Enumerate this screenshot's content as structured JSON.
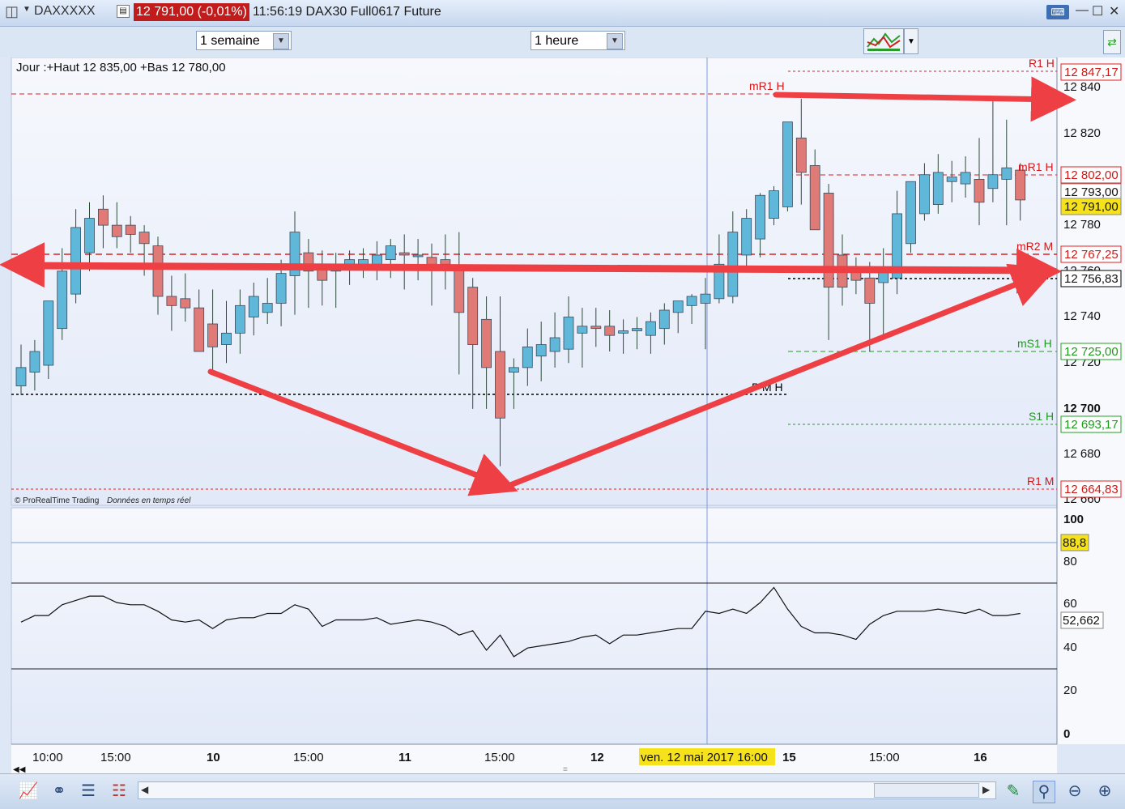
{
  "window": {
    "symbol": "DAXXXXX",
    "price_badge": "12 791,00 (-0,01%)",
    "time_title": "11:56:19 DAX30 Full0617 Future"
  },
  "toolbar": {
    "period_select": "1 semaine",
    "interval_select": "1 heure"
  },
  "chart": {
    "info_text": "Jour :+Haut 12 835,00 +Bas 12 780,00",
    "copyright": "© ProRealTime Trading",
    "realtime": "Données en temps réel",
    "crosshair_date": "ven. 12 mai 2017 16:00",
    "colors": {
      "bull": "#5fb8da",
      "bear": "#e07a77",
      "arrow": "#ee4044",
      "resistance": "#e02020",
      "support": "#20a020",
      "pivot": "#000000"
    },
    "price_ticks": [
      "12 840",
      "12 820",
      "12 780",
      "12 760",
      "12 740",
      "12 720",
      "12 700",
      "12 680",
      "12 660"
    ],
    "pivot_labels": [
      {
        "text": "R1 H",
        "tag": "12 847,17",
        "kind": "resistance"
      },
      {
        "text": "mR1 H",
        "tag": "",
        "kind": "resistance"
      },
      {
        "text": "mR1 H",
        "tag": "12 802,00",
        "kind": "resistance"
      },
      {
        "text": "mR2 M",
        "tag": "12 767,25",
        "kind": "resistance"
      },
      {
        "text": "PM",
        "tag": "12 756,83",
        "kind": "pivot"
      },
      {
        "text": "mS1 H",
        "tag": "12 725,00",
        "kind": "support"
      },
      {
        "text": "P M H",
        "tag": "",
        "kind": "pivot"
      },
      {
        "text": "S1 H",
        "tag": "12 693,17",
        "kind": "support"
      },
      {
        "text": "R1 M",
        "tag": "12 664,83",
        "kind": "resistance"
      }
    ],
    "price_tags": {
      "prev": "12 793,00",
      "last": "12 791,00"
    },
    "oscillator": {
      "ticks": [
        "100",
        "80",
        "60",
        "40",
        "20",
        "0"
      ],
      "upper_tag": "88,8",
      "value_tag": "52,662"
    },
    "x_ticks": [
      "10:00",
      "15:00",
      "10",
      "15:00",
      "11",
      "15:00",
      "12",
      "15",
      "15:00",
      "16"
    ]
  },
  "chart_data": {
    "type": "candlestick",
    "interval": "1 heure",
    "ylim": [
      12660,
      12850
    ],
    "candles": [
      {
        "o": 12710,
        "h": 12728,
        "l": 12706,
        "c": 12718
      },
      {
        "o": 12716,
        "h": 12730,
        "l": 12708,
        "c": 12725
      },
      {
        "o": 12719,
        "h": 12747,
        "l": 12713,
        "c": 12747
      },
      {
        "o": 12735,
        "h": 12770,
        "l": 12730,
        "c": 12760
      },
      {
        "o": 12750,
        "h": 12787,
        "l": 12746,
        "c": 12779
      },
      {
        "o": 12768,
        "h": 12790,
        "l": 12760,
        "c": 12783
      },
      {
        "o": 12787,
        "h": 12793,
        "l": 12770,
        "c": 12780
      },
      {
        "o": 12780,
        "h": 12790,
        "l": 12770,
        "c": 12775
      },
      {
        "o": 12780,
        "h": 12784,
        "l": 12768,
        "c": 12776
      },
      {
        "o": 12777,
        "h": 12780,
        "l": 12758,
        "c": 12772
      },
      {
        "o": 12771,
        "h": 12775,
        "l": 12741,
        "c": 12749
      },
      {
        "o": 12749,
        "h": 12758,
        "l": 12734,
        "c": 12745
      },
      {
        "o": 12748,
        "h": 12759,
        "l": 12738,
        "c": 12744
      },
      {
        "o": 12744,
        "h": 12752,
        "l": 12729,
        "c": 12725
      },
      {
        "o": 12737,
        "h": 12752,
        "l": 12716,
        "c": 12727
      },
      {
        "o": 12728,
        "h": 12747,
        "l": 12720,
        "c": 12733
      },
      {
        "o": 12733,
        "h": 12752,
        "l": 12724,
        "c": 12745
      },
      {
        "o": 12740,
        "h": 12755,
        "l": 12732,
        "c": 12749
      },
      {
        "o": 12742,
        "h": 12757,
        "l": 12737,
        "c": 12746
      },
      {
        "o": 12746,
        "h": 12765,
        "l": 12736,
        "c": 12759
      },
      {
        "o": 12758,
        "h": 12786,
        "l": 12741,
        "c": 12777
      },
      {
        "o": 12768,
        "h": 12774,
        "l": 12744,
        "c": 12760
      },
      {
        "o": 12763,
        "h": 12769,
        "l": 12745,
        "c": 12756
      },
      {
        "o": 12760,
        "h": 12768,
        "l": 12744,
        "c": 12763
      },
      {
        "o": 12763,
        "h": 12769,
        "l": 12754,
        "c": 12765
      },
      {
        "o": 12762,
        "h": 12770,
        "l": 12757,
        "c": 12765
      },
      {
        "o": 12763,
        "h": 12773,
        "l": 12756,
        "c": 12767
      },
      {
        "o": 12765,
        "h": 12774,
        "l": 12757,
        "c": 12771
      },
      {
        "o": 12768,
        "h": 12776,
        "l": 12752,
        "c": 12767
      },
      {
        "o": 12767,
        "h": 12774,
        "l": 12756,
        "c": 12767
      },
      {
        "o": 12766,
        "h": 12772,
        "l": 12745,
        "c": 12763
      },
      {
        "o": 12765,
        "h": 12776,
        "l": 12752,
        "c": 12763
      },
      {
        "o": 12762,
        "h": 12777,
        "l": 12715,
        "c": 12742
      },
      {
        "o": 12753,
        "h": 12757,
        "l": 12700,
        "c": 12728
      },
      {
        "o": 12739,
        "h": 12749,
        "l": 12700,
        "c": 12718
      },
      {
        "o": 12725,
        "h": 12749,
        "l": 12675,
        "c": 12696
      },
      {
        "o": 12716,
        "h": 12722,
        "l": 12700,
        "c": 12718
      },
      {
        "o": 12718,
        "h": 12735,
        "l": 12710,
        "c": 12727
      },
      {
        "o": 12723,
        "h": 12738,
        "l": 12712,
        "c": 12728
      },
      {
        "o": 12725,
        "h": 12742,
        "l": 12718,
        "c": 12731
      },
      {
        "o": 12726,
        "h": 12749,
        "l": 12720,
        "c": 12740
      },
      {
        "o": 12733,
        "h": 12744,
        "l": 12718,
        "c": 12736
      },
      {
        "o": 12736,
        "h": 12744,
        "l": 12727,
        "c": 12735
      },
      {
        "o": 12736,
        "h": 12743,
        "l": 12725,
        "c": 12732
      },
      {
        "o": 12733,
        "h": 12739,
        "l": 12724,
        "c": 12734
      },
      {
        "o": 12734,
        "h": 12740,
        "l": 12726,
        "c": 12735
      },
      {
        "o": 12732,
        "h": 12742,
        "l": 12724,
        "c": 12738
      },
      {
        "o": 12735,
        "h": 12746,
        "l": 12728,
        "c": 12743
      },
      {
        "o": 12742,
        "h": 12747,
        "l": 12733,
        "c": 12747
      },
      {
        "o": 12745,
        "h": 12750,
        "l": 12737,
        "c": 12749
      },
      {
        "o": 12746,
        "h": 12757,
        "l": 12726,
        "c": 12750
      },
      {
        "o": 12748,
        "h": 12776,
        "l": 12746,
        "c": 12763
      },
      {
        "o": 12749,
        "h": 12786,
        "l": 12746,
        "c": 12777
      },
      {
        "o": 12767,
        "h": 12787,
        "l": 12760,
        "c": 12783
      },
      {
        "o": 12774,
        "h": 12794,
        "l": 12766,
        "c": 12793
      },
      {
        "o": 12783,
        "h": 12797,
        "l": 12780,
        "c": 12795
      },
      {
        "o": 12788,
        "h": 12820,
        "l": 12786,
        "c": 12825
      },
      {
        "o": 12818,
        "h": 12835,
        "l": 12789,
        "c": 12803
      },
      {
        "o": 12806,
        "h": 12813,
        "l": 12779,
        "c": 12778
      },
      {
        "o": 12794,
        "h": 12798,
        "l": 12730,
        "c": 12753
      },
      {
        "o": 12767,
        "h": 12776,
        "l": 12745,
        "c": 12753
      },
      {
        "o": 12760,
        "h": 12766,
        "l": 12750,
        "c": 12756
      },
      {
        "o": 12757,
        "h": 12764,
        "l": 12725,
        "c": 12746
      },
      {
        "o": 12755,
        "h": 12770,
        "l": 12730,
        "c": 12760
      },
      {
        "o": 12757,
        "h": 12795,
        "l": 12750,
        "c": 12785
      },
      {
        "o": 12772,
        "h": 12796,
        "l": 12768,
        "c": 12799
      },
      {
        "o": 12785,
        "h": 12807,
        "l": 12782,
        "c": 12802
      },
      {
        "o": 12789,
        "h": 12811,
        "l": 12785,
        "c": 12803
      },
      {
        "o": 12799,
        "h": 12808,
        "l": 12790,
        "c": 12801
      },
      {
        "o": 12798,
        "h": 12810,
        "l": 12792,
        "c": 12803
      },
      {
        "o": 12800,
        "h": 12818,
        "l": 12780,
        "c": 12790
      },
      {
        "o": 12796,
        "h": 12834,
        "l": 12790,
        "c": 12802
      },
      {
        "o": 12800,
        "h": 12826,
        "l": 12780,
        "c": 12805
      },
      {
        "o": 12804,
        "h": 12807,
        "l": 12782,
        "c": 12791
      }
    ],
    "oscillator_series": [
      52,
      55,
      55,
      60,
      62,
      64,
      64,
      61,
      60,
      60,
      57,
      53,
      52,
      53,
      49,
      53,
      54,
      54,
      56,
      56,
      60,
      58,
      50,
      53,
      53,
      53,
      54,
      51,
      52,
      53,
      52,
      50,
      46,
      48,
      39,
      46,
      36,
      40,
      41,
      42,
      43,
      45,
      46,
      42,
      46,
      46,
      47,
      48,
      49,
      49,
      57,
      56,
      58,
      56,
      61,
      68,
      58,
      50,
      47,
      47,
      46,
      44,
      51,
      55,
      57,
      57,
      57,
      58,
      57,
      56,
      58,
      55,
      55,
      56
    ]
  }
}
